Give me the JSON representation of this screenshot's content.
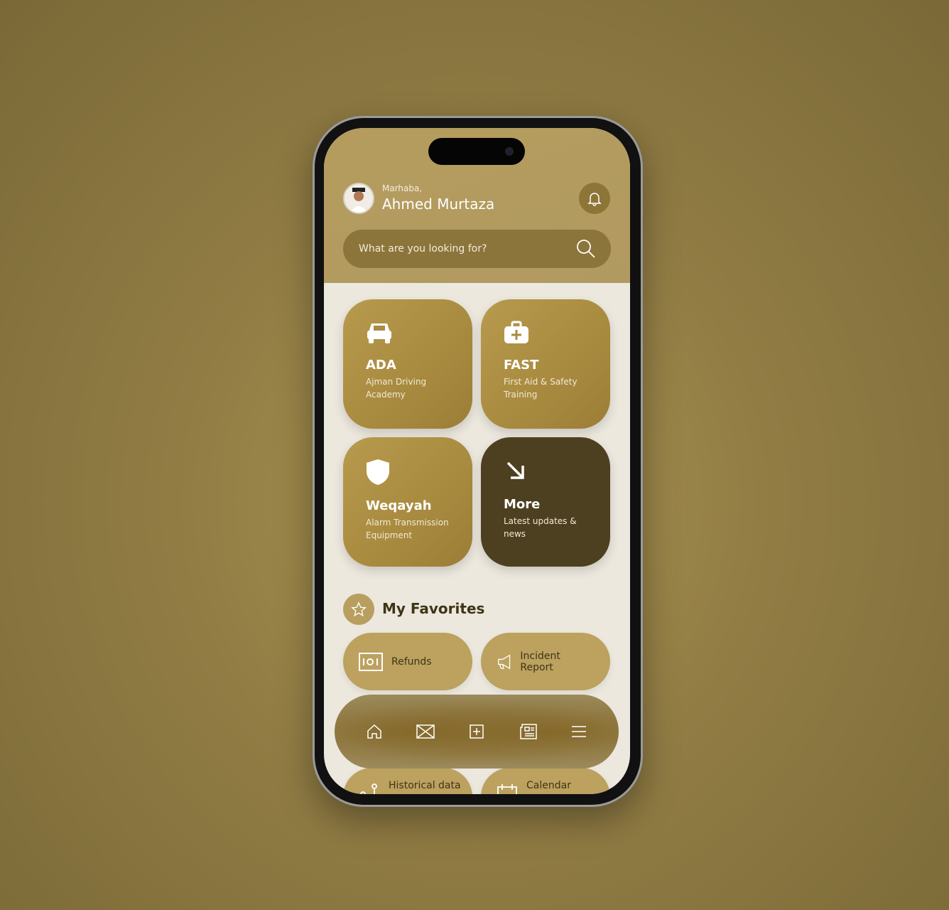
{
  "header": {
    "greeting": "Marhaba,",
    "user_name": "Ahmed Murtaza"
  },
  "search": {
    "placeholder": "What are you looking for?"
  },
  "services": [
    {
      "title": "ADA",
      "subtitle": "Ajman Driving Academy",
      "icon": "car-icon"
    },
    {
      "title": "FAST",
      "subtitle": "First Aid & Safety Training",
      "icon": "first-aid-kit-icon"
    },
    {
      "title": "Weqayah",
      "subtitle": "Alarm Transmission Equipment",
      "icon": "shield-icon"
    },
    {
      "title": "More",
      "subtitle": "Latest updates & news",
      "icon": "arrow-down-right-icon"
    }
  ],
  "favorites": {
    "title": "My Favorites",
    "items": [
      {
        "label": "Refunds",
        "icon": "money-icon"
      },
      {
        "label": "Incident Report",
        "icon": "megaphone-icon"
      },
      {
        "label": "Historical data",
        "icon": "route-icon"
      },
      {
        "label": "Calendar",
        "icon": "calendar-icon"
      }
    ]
  },
  "nav": [
    "home",
    "messages",
    "add",
    "news",
    "menu"
  ],
  "colors": {
    "accent": "#b89f60",
    "dark": "#4d4020",
    "background": "#ece8de"
  }
}
